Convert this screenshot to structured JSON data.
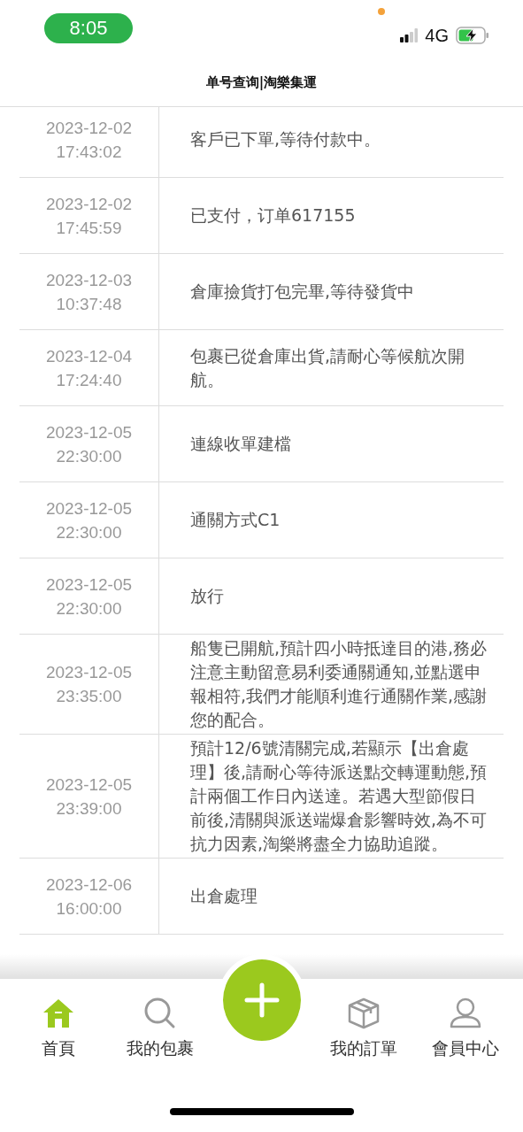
{
  "status_bar": {
    "time": "8:05",
    "network": "4G"
  },
  "title": "单号查询|淘樂集運",
  "events": [
    {
      "date": "2023-12-02",
      "time": "17:43:02",
      "text": "客戶已下單,等待付款中。"
    },
    {
      "date": "2023-12-02",
      "time": "17:45:59",
      "text": "已支付，订单617155"
    },
    {
      "date": "2023-12-03",
      "time": "10:37:48",
      "text": "倉庫撿貨打包完畢,等待發貨中"
    },
    {
      "date": "2023-12-04",
      "time": "17:24:40",
      "text": "包裹已從倉庫出貨,請耐心等候航次開航。"
    },
    {
      "date": "2023-12-05",
      "time": "22:30:00",
      "text": "連線收單建檔"
    },
    {
      "date": "2023-12-05",
      "time": "22:30:00",
      "text": "通關方式C1"
    },
    {
      "date": "2023-12-05",
      "time": "22:30:00",
      "text": "放行"
    },
    {
      "date": "2023-12-05",
      "time": "23:35:00",
      "text": "船隻已開航,預計四小時抵達目的港,務必注意主動留意易利委通關通知,並點選申報相符,我們才能順利進行通關作業,感謝您的配合。"
    },
    {
      "date": "2023-12-05",
      "time": "23:39:00",
      "text": "預計12/6號清關完成,若顯示【出倉處理】後,請耐心等待派送點交轉運動態,預計兩個工作日內送達。若遇大型節假日前後,清關與派送端爆倉影響時效,為不可抗力因素,淘樂將盡全力協助追蹤。"
    },
    {
      "date": "2023-12-06",
      "time": "16:00:00",
      "text": "出倉處理"
    }
  ],
  "nav": [
    {
      "kind": "home",
      "label": "首頁",
      "selected": true
    },
    {
      "kind": "search",
      "label": "我的包裹",
      "selected": false
    },
    {
      "kind": "add"
    },
    {
      "kind": "box",
      "label": "我的訂單",
      "selected": false
    },
    {
      "kind": "user",
      "label": "會員中心",
      "selected": false
    }
  ]
}
